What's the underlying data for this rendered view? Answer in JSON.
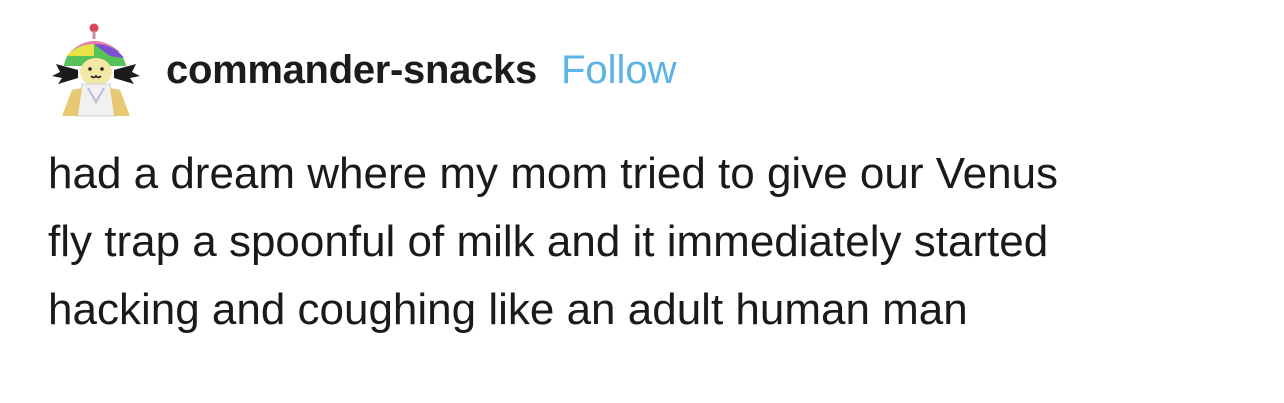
{
  "post": {
    "username": "commander-snacks",
    "follow_label": "Follow",
    "text": "had a dream where my mom tried to give our Venus\nfly trap a spoonful of milk and it immediately started\nhacking and coughing like an adult human man"
  },
  "colors": {
    "follow": "#5bb3e6",
    "text": "#1a1a1a"
  },
  "icons": {
    "avatar": "avatar-icon"
  }
}
